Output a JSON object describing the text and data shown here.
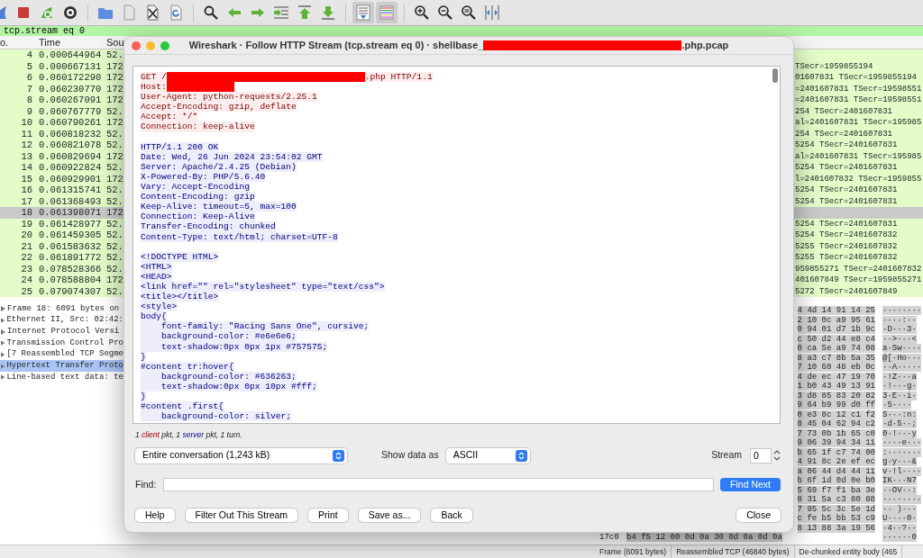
{
  "toolbar": [
    {
      "selected": false
    },
    {
      "selected": false
    },
    {
      "selected": false
    },
    {
      "selected": false
    },
    {
      "selected": false
    },
    {
      "selected": false
    },
    {
      "selected": false
    },
    {
      "selected": false
    },
    {
      "selected": false
    },
    {
      "selected": false
    },
    {
      "selected": false
    },
    {
      "selected": false
    },
    {
      "selected": false
    },
    {
      "selected": false
    },
    {
      "selected": true
    },
    {
      "selected": true
    },
    {
      "selected": false
    },
    {
      "selected": false
    },
    {
      "selected": false
    },
    {
      "selected": false
    }
  ],
  "filter": {
    "value": "tcp.stream eq 0"
  },
  "packet_list": {
    "columns": [
      "o.",
      "Time",
      "Sou"
    ],
    "rows": [
      {
        "no": "4",
        "time": "0.000644964",
        "source": "52.",
        "selected": false
      },
      {
        "no": "5",
        "time": "0.000667131",
        "source": "172",
        "info": "TSecr=1959855194",
        "selected": false
      },
      {
        "no": "6",
        "time": "0.060172290",
        "source": "172",
        "info": "01607831 TSecr=1959855194",
        "selected": false
      },
      {
        "no": "7",
        "time": "0.060230770",
        "source": "172",
        "info": "=2401607831 TSecr=19598551",
        "selected": false
      },
      {
        "no": "8",
        "time": "0.060267091",
        "source": "172",
        "info": "=2401607831 TSecr=19598551",
        "selected": false
      },
      {
        "no": "9",
        "time": "0.060767779",
        "source": "52.",
        "info": "254 TSecr=2401607831",
        "selected": false
      },
      {
        "no": "10",
        "time": "0.060790261",
        "source": "172",
        "info": "al=2401607831 TSecr=195985",
        "selected": false
      },
      {
        "no": "11",
        "time": "0.060818232",
        "source": "52.",
        "info": "254 TSecr=2401607831",
        "selected": false
      },
      {
        "no": "12",
        "time": "0.060821078",
        "source": "52.",
        "info": "5254 TSecr=2401607831",
        "selected": false
      },
      {
        "no": "13",
        "time": "0.060829694",
        "source": "172",
        "info": "al=2401607831 TSecr=195985",
        "selected": false
      },
      {
        "no": "14",
        "time": "0.060922824",
        "source": "52.",
        "info": "5254 TSecr=2401607831",
        "selected": false
      },
      {
        "no": "15",
        "time": "0.060929901",
        "source": "172",
        "info": "l=2401607832 TSecr=1959855",
        "selected": false
      },
      {
        "no": "16",
        "time": "0.061315741",
        "source": "52.",
        "info": "5254 TSecr=2401607831",
        "selected": false
      },
      {
        "no": "17",
        "time": "0.061368493",
        "source": "52.",
        "info": "5254 TSecr=2401607831",
        "selected": false
      },
      {
        "no": "18",
        "time": "0.061398071",
        "source": "172",
        "selected": true
      },
      {
        "no": "19",
        "time": "0.061428977",
        "source": "52.",
        "info": "5254 TSecr=2401607831",
        "selected": false
      },
      {
        "no": "20",
        "time": "0.061459305",
        "source": "52.",
        "info": "5254 TSecr=2401607832",
        "selected": false
      },
      {
        "no": "21",
        "time": "0.061583632",
        "source": "52.",
        "info": "5255 TSecr=2401607832",
        "selected": false
      },
      {
        "no": "22",
        "time": "0.061891772",
        "source": "52.",
        "info": "5255 TSecr=2401607832",
        "selected": false
      },
      {
        "no": "23",
        "time": "0.078528366",
        "source": "52.",
        "info": "959855271 TSecr=2401607832",
        "selected": false
      },
      {
        "no": "24",
        "time": "0.078588804",
        "source": "172",
        "info": "401607849 TSecr=1959855271",
        "selected": false
      },
      {
        "no": "25",
        "time": "0.079074307",
        "source": "52.",
        "info": "5272 TSecr=2401607849",
        "selected": false
      }
    ]
  },
  "details": [
    {
      "text": "Frame 18: 6091 bytes on",
      "selected": false
    },
    {
      "text": "Ethernet II, Src: 02:42:",
      "selected": false
    },
    {
      "text": "Internet Protocol Versi",
      "selected": false
    },
    {
      "text": "Transmission Control Pro",
      "selected": false
    },
    {
      "text": "[7 Reassembled TCP Segme",
      "selected": false
    },
    {
      "text": "Hypertext Transfer Proto",
      "selected": true
    },
    {
      "text": "Line-based text data: te",
      "selected": false
    }
  ],
  "bytes": [
    {
      "hex": "4 4d 14 91 14 25",
      "ascii": "········"
    },
    {
      "hex": "2 10 0c a9 95 61",
      "ascii": "····:··"
    },
    {
      "hex": "0 94 01 d7 1b 9c",
      "ascii": "·D···3·"
    },
    {
      "hex": "c 50 d2 44 e8 c4",
      "ascii": "··>···<"
    },
    {
      "hex": "0 ca 5e a9 74 08",
      "ascii": "a·Sw····"
    },
    {
      "hex": "8 a3 c7 8b 5a 35",
      "ascii": "@[·Ho···"
    },
    {
      "hex": "7 10 60 48 eb 0c",
      "ascii": "··A·····"
    },
    {
      "hex": "4 de ec 47 19 70",
      "ascii": "·!Z···a"
    },
    {
      "hex": "1 b0 43 49 13 91",
      "ascii": "·!···g·"
    },
    {
      "hex": "3 d8 85 83 20 82",
      "ascii": "3·E··i·"
    },
    {
      "hex": "9 64 b9 99 d0 ff",
      "ascii": "·5····"
    },
    {
      "hex": "0 e3 8c 12 c1 f2",
      "ascii": "S···:n:"
    },
    {
      "hex": "8 45 04 62 94 c2",
      "ascii": "·d·5··;"
    },
    {
      "hex": "7 73 0b 1b 65 c0",
      "ascii": "0·!···y"
    },
    {
      "hex": "9 06 39 94 34 11",
      "ascii": "····e···"
    },
    {
      "hex": "b 65 1f c7 74 00",
      "ascii": ":·······"
    },
    {
      "hex": "4 91 8c 2e ef ec",
      "ascii": "g·y···&"
    },
    {
      "hex": "a 06 44 d4 44 11",
      "ascii": "v·!l····"
    },
    {
      "hex": "b 6f 1d 0d 0e b0",
      "ascii": "IK···N7"
    },
    {
      "hex": "5 69 f7 f1 ba 3e",
      "ascii": "··OV··:"
    },
    {
      "hex": "8 31 5a c3 80 88",
      "ascii": "········"
    },
    {
      "hex": "7 95 5c 3c 5e 1d",
      "ascii": "·· )···"
    },
    {
      "hex": "c fe b5 bb 53 c9",
      "ascii": "U····0·"
    },
    {
      "hex": "8 13 88 3a 19 56",
      "ascii": "·4··?··"
    },
    {
      "offset": "17c0",
      "hex": "b4 f5 12 00 0d 0a 30 0d  0a 0d 0a",
      "ascii": "······0"
    }
  ],
  "byte_tabs": [
    {
      "label": "Frame (6091 bytes)",
      "selected": false
    },
    {
      "label": "Reassembled TCP (46840 bytes)",
      "selected": false
    },
    {
      "label": "De-chunked entity body (465",
      "selected": false
    }
  ],
  "dialog": {
    "title": [
      {
        "text": "Wireshark · Follow HTTP Stream (tcp.stream eq 0) · shellbase_"
      },
      {
        "kind": "redaction",
        "long": true
      },
      {
        "text": ".php.pcap"
      }
    ],
    "segments": [
      {
        "kind": "client",
        "lines": [
          [
            {
              "text": "GET /"
            },
            {
              "kind": "redaction",
              "long": true
            },
            {
              "text": ".php HTTP/1.1"
            }
          ],
          [
            {
              "text": "Host:"
            },
            {
              "kind": "redaction",
              "long": false
            }
          ],
          [
            {
              "text": "User-Agent: python-requests/2.25.1"
            }
          ],
          [
            {
              "text": "Accept-Encoding: gzip, deflate"
            }
          ],
          [
            {
              "text": "Accept: */*"
            }
          ],
          [
            {
              "text": "Connection: keep-alive"
            }
          ]
        ]
      },
      {
        "kind": "server",
        "lines": [
          [
            {
              "text": "HTTP/1.1 200 OK"
            }
          ],
          [
            {
              "text": "Date: Wed, 26 Jun 2024 23:54:02 GMT"
            }
          ],
          [
            {
              "text": "Server: Apache/2.4.25 (Debian)"
            }
          ],
          [
            {
              "text": "X-Powered-By: PHP/5.6.40"
            }
          ],
          [
            {
              "text": "Vary: Accept-Encoding"
            }
          ],
          [
            {
              "text": "Content-Encoding: gzip"
            }
          ],
          [
            {
              "text": "Keep-Alive: timeout=5, max=100"
            }
          ],
          [
            {
              "text": "Connection: Keep-Alive"
            }
          ],
          [
            {
              "text": "Transfer-Encoding: chunked"
            }
          ],
          [
            {
              "text": "Content-Type: text/html; charset=UTF-8"
            }
          ]
        ]
      },
      {
        "kind": "server",
        "lines": [
          [
            {
              "text": "<!DOCTYPE HTML>"
            }
          ],
          [
            {
              "text": "<HTML>"
            }
          ],
          [
            {
              "text": "<HEAD>"
            }
          ],
          [
            {
              "text": "<link href=\"\" rel=\"stylesheet\" type=\"text/css\">"
            }
          ],
          [
            {
              "text": "<title></title>"
            }
          ],
          [
            {
              "text": "<style>"
            }
          ],
          [
            {
              "text": "body{"
            }
          ],
          [
            {
              "text": "    font-family: \"Racing Sans One\", cursive;"
            }
          ],
          [
            {
              "text": "    background-color: #e6e6e6;"
            }
          ],
          [
            {
              "text": "    text-shadow:0px 0px 1px #757575;"
            }
          ],
          [
            {
              "text": "}"
            }
          ],
          [
            {
              "text": "#content tr:hover{"
            }
          ],
          [
            {
              "text": "    background-color: #636263;"
            }
          ],
          [
            {
              "text": "    text-shadow:0px 0px 10px #fff;"
            }
          ],
          [
            {
              "text": "}"
            }
          ],
          [
            {
              "text": "#content .first{"
            }
          ],
          [
            {
              "text": "    background-color: silver;"
            }
          ]
        ]
      }
    ],
    "summary": [
      {
        "text": "1 "
      },
      {
        "text": "client",
        "kind": "client"
      },
      {
        "text": " pkt, 1 "
      },
      {
        "text": "server",
        "kind": "server"
      },
      {
        "text": " pkt, 1 turn."
      }
    ],
    "conversation": {
      "value": "Entire conversation (1,243 kB)"
    },
    "show_as": {
      "label": "Show data as",
      "value": "ASCII"
    },
    "stream": {
      "label": "Stream",
      "value": "0"
    },
    "find": {
      "label": "Find:",
      "button": "Find Next"
    },
    "buttons": [
      "Help",
      "Filter Out This Stream",
      "Print",
      "Save as...",
      "Back"
    ],
    "close": "Close"
  }
}
